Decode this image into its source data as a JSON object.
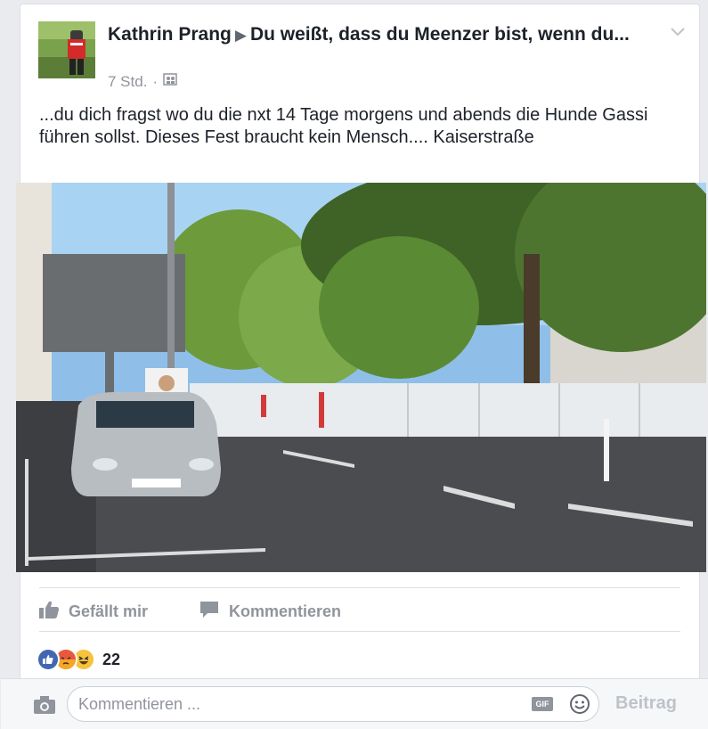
{
  "post": {
    "author": "Kathrin Prang",
    "arrow": "▶",
    "group": "Du weißt, dass du Meenzer bist, wenn du...",
    "time": "7 Std.",
    "separator": "·",
    "audience_icon": "group-icon",
    "menu_icon": "chevron-down-icon",
    "text": "...du dich fragst wo du die nxt 14 Tage morgens und abends die Hunde Gassi führen sollst. Dieses Fest braucht kein Mensch.... Kaiserstraße"
  },
  "actions": {
    "like_label": "Gefällt mir",
    "like_icon": "thumbs-up-icon",
    "comment_label": "Kommentieren",
    "comment_icon": "speech-bubble-icon"
  },
  "reactions": {
    "icons": [
      "like-reaction-icon",
      "angry-reaction-icon",
      "haha-reaction-icon"
    ],
    "count": "22"
  },
  "composer": {
    "camera_icon": "camera-icon",
    "placeholder": "Kommentieren ...",
    "gif_label": "GIF",
    "emoji_icon": "smiley-icon",
    "post_label": "Beitrag"
  },
  "colors": {
    "brand_like": "#4267b2",
    "text_primary": "#1d2129",
    "text_secondary": "#90949c",
    "disabled": "#bec3c9"
  }
}
